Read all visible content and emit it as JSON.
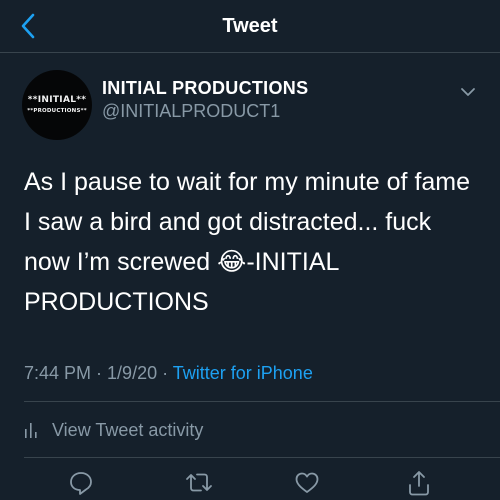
{
  "header": {
    "title": "Tweet",
    "back_icon": "chevron-left-icon"
  },
  "tweet": {
    "avatar_line1": "**INITIAL**",
    "avatar_line2": "**PRODUCTIONS**",
    "author_name": "INITIAL PRODUCTIONS",
    "author_handle": "@INITIALPRODUCT1",
    "text_before_emoji": "As I pause to wait for my minute of fame I saw a bird and got distracted... fuck now I’m screwed ",
    "emoji": "😂",
    "text_after_emoji": "-INITIAL PRODUCTIONS",
    "time": "7:44 PM",
    "date": "1/9/20",
    "source": "Twitter for iPhone",
    "separator": " · "
  },
  "activity": {
    "label": "View Tweet activity",
    "icon": "bar-chart-icon"
  },
  "actions": [
    "reply-icon",
    "retweet-icon",
    "like-icon",
    "share-icon"
  ],
  "colors": {
    "background": "#15202b",
    "accent": "#1da1f2",
    "secondary_text": "#8899a6",
    "divider": "#38444d"
  }
}
